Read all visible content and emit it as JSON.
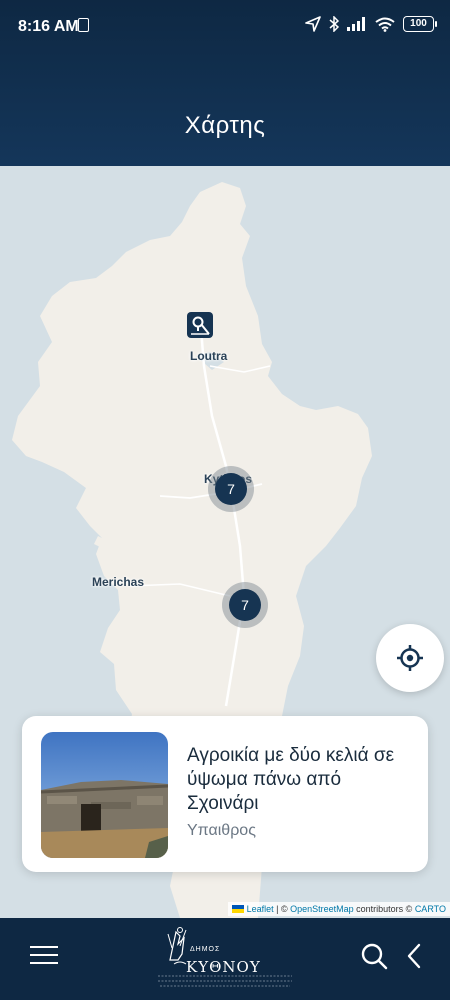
{
  "status_bar": {
    "time": "8:16 AM",
    "battery": "100"
  },
  "header": {
    "title": "Χάρτης"
  },
  "map": {
    "labels": {
      "loutra": "Loutra",
      "kythnos": "Kythnos",
      "merichas": "Merichas"
    },
    "clusters": [
      {
        "count": "7"
      },
      {
        "count": "7"
      }
    ],
    "attribution": {
      "leaflet": "Leaflet",
      "sep": " | © ",
      "osm": "OpenStreetMap",
      "contributors": " contributors © ",
      "carto": "CARTO"
    }
  },
  "card": {
    "title": "Αγροικία με δύο κελιά σε ύψωμα πάνω από Σχοινάρι",
    "subtitle": "Υπαιθρος"
  },
  "bottom_bar": {
    "logo_name": "ΚΥΘΝΟΥ",
    "logo_prefix": "ΔΗΜΟΣ"
  },
  "colors": {
    "header": "#0e2843",
    "accent": "#163452",
    "land": "#f2efe9",
    "sea": "#d4dfe5"
  }
}
